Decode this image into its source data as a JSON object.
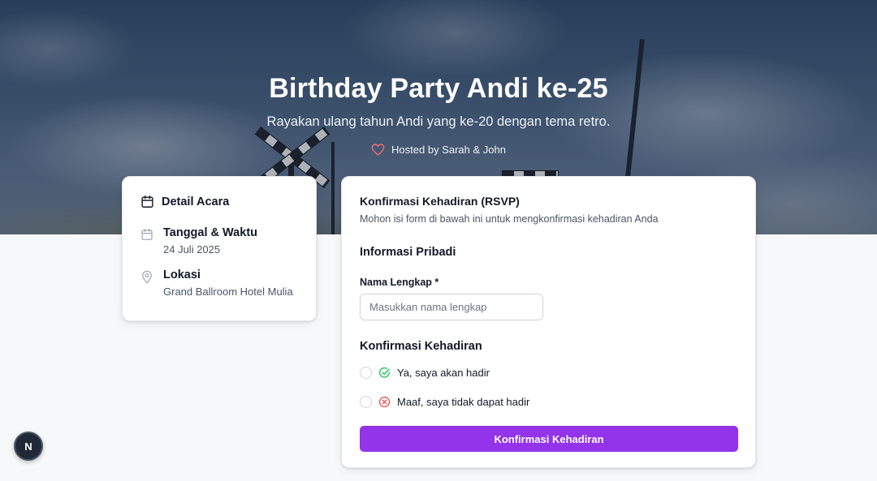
{
  "hero": {
    "title": "Birthday Party Andi ke-25",
    "subtitle": "Rayakan ulang tahun Andi yang ke-20 dengan tema retro.",
    "host": "Hosted by Sarah & John",
    "host_icon": "heart-icon"
  },
  "details": {
    "heading": "Detail Acara",
    "heading_icon": "calendar-icon",
    "date_label": "Tanggal & Waktu",
    "date_value": "24 Juli 2025",
    "location_label": "Lokasi",
    "location_value": "Grand Ballroom Hotel Mulia",
    "location_icon": "map-pin-icon"
  },
  "rsvp": {
    "title": "Konfirmasi Kehadiran (RSVP)",
    "description": "Mohon isi form di bawah ini untuk mengkonfirmasi kehadiran Anda",
    "personal_section": "Informasi Pribadi",
    "name_label": "Nama Lengkap *",
    "name_placeholder": "Masukkan nama lengkap",
    "name_value": "",
    "attendance_section": "Konfirmasi Kehadiran",
    "option_yes": "Ya, saya akan hadir",
    "option_no": "Maaf, saya tidak dapat hadir",
    "submit_label": "Konfirmasi Kehadiran"
  },
  "fab": {
    "label": "N"
  },
  "colors": {
    "accent": "#9333ea",
    "heart": "#f87171",
    "check": "#22c55e",
    "cross": "#ef4444"
  }
}
